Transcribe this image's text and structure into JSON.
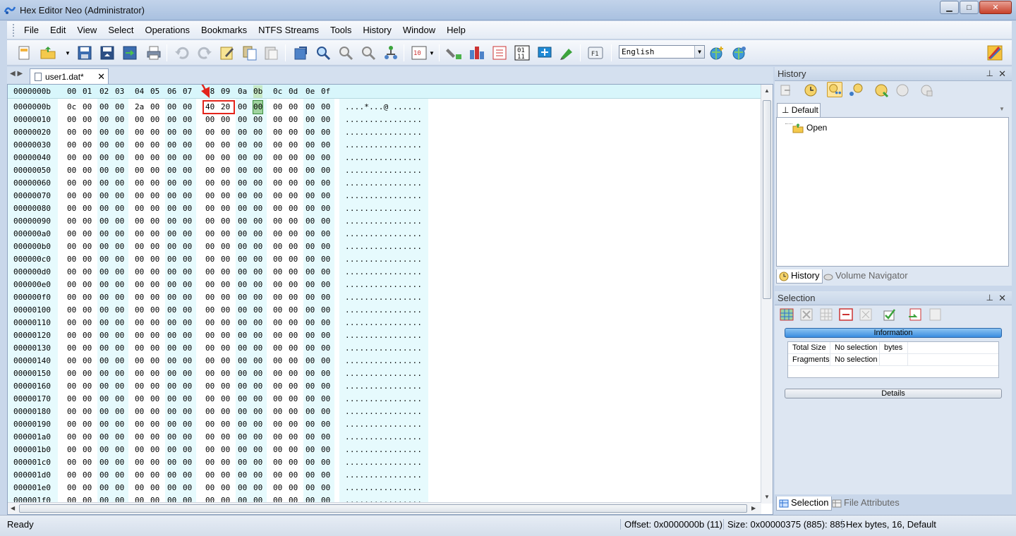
{
  "window": {
    "title": "Hex Editor Neo (Administrator)",
    "minimize": "▁",
    "maximize": "□",
    "close": "✕"
  },
  "menu": [
    "File",
    "Edit",
    "View",
    "Select",
    "Operations",
    "Bookmarks",
    "NTFS Streams",
    "Tools",
    "History",
    "Window",
    "Help"
  ],
  "toolbar": {
    "language": "English",
    "icons": [
      "new-file-icon",
      "open-folder-icon",
      "save-icon",
      "save-all-icon",
      "save-as-icon",
      "print-icon",
      "undo-icon",
      "redo-icon",
      "edit-icon",
      "copy-icon",
      "paste-icon",
      "export-icon",
      "find-icon",
      "find-next-icon",
      "find-previous-icon",
      "bookmark-tree-icon",
      "hex-edit-icon",
      "pipe-icon",
      "structure-icon",
      "binary-icon",
      "fullscreen-icon",
      "marker-icon",
      "help-f1-icon",
      "globe-plus-icon",
      "globe-refresh-icon",
      "settings-icon"
    ]
  },
  "document": {
    "tab_label": "user1.dat*",
    "close_symbol": "✕"
  },
  "hex": {
    "header_offset": "0000000b",
    "columns": [
      "00",
      "01",
      "02",
      "03",
      "04",
      "05",
      "06",
      "07",
      "08",
      "09",
      "0a",
      "0b",
      "0c",
      "0d",
      "0e",
      "0f"
    ],
    "rows": [
      {
        "addr": "0000000b",
        "bytes": [
          "0c",
          "00",
          "00",
          "00",
          "2a",
          "00",
          "00",
          "00",
          "40",
          "20",
          "00",
          "00",
          "00",
          "00",
          "00",
          "00"
        ],
        "ascii": "....*...@ ......"
      },
      {
        "addr": "00000010",
        "bytes": [
          "00",
          "00",
          "00",
          "00",
          "00",
          "00",
          "00",
          "00",
          "00",
          "00",
          "00",
          "00",
          "00",
          "00",
          "00",
          "00"
        ],
        "ascii": "................"
      },
      {
        "addr": "00000020",
        "bytes": [
          "00",
          "00",
          "00",
          "00",
          "00",
          "00",
          "00",
          "00",
          "00",
          "00",
          "00",
          "00",
          "00",
          "00",
          "00",
          "00"
        ],
        "ascii": "................"
      },
      {
        "addr": "00000030",
        "bytes": [
          "00",
          "00",
          "00",
          "00",
          "00",
          "00",
          "00",
          "00",
          "00",
          "00",
          "00",
          "00",
          "00",
          "00",
          "00",
          "00"
        ],
        "ascii": "................"
      },
      {
        "addr": "00000040",
        "bytes": [
          "00",
          "00",
          "00",
          "00",
          "00",
          "00",
          "00",
          "00",
          "00",
          "00",
          "00",
          "00",
          "00",
          "00",
          "00",
          "00"
        ],
        "ascii": "................"
      },
      {
        "addr": "00000050",
        "bytes": [
          "00",
          "00",
          "00",
          "00",
          "00",
          "00",
          "00",
          "00",
          "00",
          "00",
          "00",
          "00",
          "00",
          "00",
          "00",
          "00"
        ],
        "ascii": "................"
      },
      {
        "addr": "00000060",
        "bytes": [
          "00",
          "00",
          "00",
          "00",
          "00",
          "00",
          "00",
          "00",
          "00",
          "00",
          "00",
          "00",
          "00",
          "00",
          "00",
          "00"
        ],
        "ascii": "................"
      },
      {
        "addr": "00000070",
        "bytes": [
          "00",
          "00",
          "00",
          "00",
          "00",
          "00",
          "00",
          "00",
          "00",
          "00",
          "00",
          "00",
          "00",
          "00",
          "00",
          "00"
        ],
        "ascii": "................"
      },
      {
        "addr": "00000080",
        "bytes": [
          "00",
          "00",
          "00",
          "00",
          "00",
          "00",
          "00",
          "00",
          "00",
          "00",
          "00",
          "00",
          "00",
          "00",
          "00",
          "00"
        ],
        "ascii": "................"
      },
      {
        "addr": "00000090",
        "bytes": [
          "00",
          "00",
          "00",
          "00",
          "00",
          "00",
          "00",
          "00",
          "00",
          "00",
          "00",
          "00",
          "00",
          "00",
          "00",
          "00"
        ],
        "ascii": "................"
      },
      {
        "addr": "000000a0",
        "bytes": [
          "00",
          "00",
          "00",
          "00",
          "00",
          "00",
          "00",
          "00",
          "00",
          "00",
          "00",
          "00",
          "00",
          "00",
          "00",
          "00"
        ],
        "ascii": "................"
      },
      {
        "addr": "000000b0",
        "bytes": [
          "00",
          "00",
          "00",
          "00",
          "00",
          "00",
          "00",
          "00",
          "00",
          "00",
          "00",
          "00",
          "00",
          "00",
          "00",
          "00"
        ],
        "ascii": "................"
      },
      {
        "addr": "000000c0",
        "bytes": [
          "00",
          "00",
          "00",
          "00",
          "00",
          "00",
          "00",
          "00",
          "00",
          "00",
          "00",
          "00",
          "00",
          "00",
          "00",
          "00"
        ],
        "ascii": "................"
      },
      {
        "addr": "000000d0",
        "bytes": [
          "00",
          "00",
          "00",
          "00",
          "00",
          "00",
          "00",
          "00",
          "00",
          "00",
          "00",
          "00",
          "00",
          "00",
          "00",
          "00"
        ],
        "ascii": "................"
      },
      {
        "addr": "000000e0",
        "bytes": [
          "00",
          "00",
          "00",
          "00",
          "00",
          "00",
          "00",
          "00",
          "00",
          "00",
          "00",
          "00",
          "00",
          "00",
          "00",
          "00"
        ],
        "ascii": "................"
      },
      {
        "addr": "000000f0",
        "bytes": [
          "00",
          "00",
          "00",
          "00",
          "00",
          "00",
          "00",
          "00",
          "00",
          "00",
          "00",
          "00",
          "00",
          "00",
          "00",
          "00"
        ],
        "ascii": "................"
      },
      {
        "addr": "00000100",
        "bytes": [
          "00",
          "00",
          "00",
          "00",
          "00",
          "00",
          "00",
          "00",
          "00",
          "00",
          "00",
          "00",
          "00",
          "00",
          "00",
          "00"
        ],
        "ascii": "................"
      },
      {
        "addr": "00000110",
        "bytes": [
          "00",
          "00",
          "00",
          "00",
          "00",
          "00",
          "00",
          "00",
          "00",
          "00",
          "00",
          "00",
          "00",
          "00",
          "00",
          "00"
        ],
        "ascii": "................"
      },
      {
        "addr": "00000120",
        "bytes": [
          "00",
          "00",
          "00",
          "00",
          "00",
          "00",
          "00",
          "00",
          "00",
          "00",
          "00",
          "00",
          "00",
          "00",
          "00",
          "00"
        ],
        "ascii": "................"
      },
      {
        "addr": "00000130",
        "bytes": [
          "00",
          "00",
          "00",
          "00",
          "00",
          "00",
          "00",
          "00",
          "00",
          "00",
          "00",
          "00",
          "00",
          "00",
          "00",
          "00"
        ],
        "ascii": "................"
      },
      {
        "addr": "00000140",
        "bytes": [
          "00",
          "00",
          "00",
          "00",
          "00",
          "00",
          "00",
          "00",
          "00",
          "00",
          "00",
          "00",
          "00",
          "00",
          "00",
          "00"
        ],
        "ascii": "................"
      },
      {
        "addr": "00000150",
        "bytes": [
          "00",
          "00",
          "00",
          "00",
          "00",
          "00",
          "00",
          "00",
          "00",
          "00",
          "00",
          "00",
          "00",
          "00",
          "00",
          "00"
        ],
        "ascii": "................"
      },
      {
        "addr": "00000160",
        "bytes": [
          "00",
          "00",
          "00",
          "00",
          "00",
          "00",
          "00",
          "00",
          "00",
          "00",
          "00",
          "00",
          "00",
          "00",
          "00",
          "00"
        ],
        "ascii": "................"
      },
      {
        "addr": "00000170",
        "bytes": [
          "00",
          "00",
          "00",
          "00",
          "00",
          "00",
          "00",
          "00",
          "00",
          "00",
          "00",
          "00",
          "00",
          "00",
          "00",
          "00"
        ],
        "ascii": "................"
      },
      {
        "addr": "00000180",
        "bytes": [
          "00",
          "00",
          "00",
          "00",
          "00",
          "00",
          "00",
          "00",
          "00",
          "00",
          "00",
          "00",
          "00",
          "00",
          "00",
          "00"
        ],
        "ascii": "................"
      },
      {
        "addr": "00000190",
        "bytes": [
          "00",
          "00",
          "00",
          "00",
          "00",
          "00",
          "00",
          "00",
          "00",
          "00",
          "00",
          "00",
          "00",
          "00",
          "00",
          "00"
        ],
        "ascii": "................"
      },
      {
        "addr": "000001a0",
        "bytes": [
          "00",
          "00",
          "00",
          "00",
          "00",
          "00",
          "00",
          "00",
          "00",
          "00",
          "00",
          "00",
          "00",
          "00",
          "00",
          "00"
        ],
        "ascii": "................"
      },
      {
        "addr": "000001b0",
        "bytes": [
          "00",
          "00",
          "00",
          "00",
          "00",
          "00",
          "00",
          "00",
          "00",
          "00",
          "00",
          "00",
          "00",
          "00",
          "00",
          "00"
        ],
        "ascii": "................"
      },
      {
        "addr": "000001c0",
        "bytes": [
          "00",
          "00",
          "00",
          "00",
          "00",
          "00",
          "00",
          "00",
          "00",
          "00",
          "00",
          "00",
          "00",
          "00",
          "00",
          "00"
        ],
        "ascii": "................"
      },
      {
        "addr": "000001d0",
        "bytes": [
          "00",
          "00",
          "00",
          "00",
          "00",
          "00",
          "00",
          "00",
          "00",
          "00",
          "00",
          "00",
          "00",
          "00",
          "00",
          "00"
        ],
        "ascii": "................"
      },
      {
        "addr": "000001e0",
        "bytes": [
          "00",
          "00",
          "00",
          "00",
          "00",
          "00",
          "00",
          "00",
          "00",
          "00",
          "00",
          "00",
          "00",
          "00",
          "00",
          "00"
        ],
        "ascii": "................"
      },
      {
        "addr": "000001f0",
        "bytes": [
          "00",
          "00",
          "00",
          "00",
          "00",
          "00",
          "00",
          "00",
          "00",
          "00",
          "00",
          "00",
          "00",
          "00",
          "00",
          "00"
        ],
        "ascii": "................"
      }
    ],
    "selected_offset": "0000000b",
    "selected_column": "0b",
    "highlighted_bytes": [
      "40",
      "20"
    ]
  },
  "history_panel": {
    "title": "History",
    "pin": "⊥",
    "close": "✕",
    "tab": "Default",
    "tree_items": [
      "Open"
    ],
    "bottom_tabs": [
      "History",
      "Volume Navigator"
    ]
  },
  "selection_panel": {
    "title": "Selection",
    "pin": "⊥",
    "close": "✕",
    "information_label": "Information",
    "details_label": "Details",
    "rows": [
      {
        "label": "Total Size",
        "value": "No selection",
        "unit": "bytes"
      },
      {
        "label": "Fragments",
        "value": "No selection",
        "unit": ""
      }
    ],
    "bottom_tabs": [
      "Selection",
      "File Attributes"
    ]
  },
  "status": {
    "ready": "Ready",
    "offset": "Offset: 0x0000000b (11)",
    "size": "Size: 0x00000375 (885): 885",
    "mode": "Hex bytes, 16, Default"
  },
  "colors": {
    "accent": "#3a8c3a",
    "highlight_box": "#e3241b",
    "band": "#e6fafd"
  }
}
